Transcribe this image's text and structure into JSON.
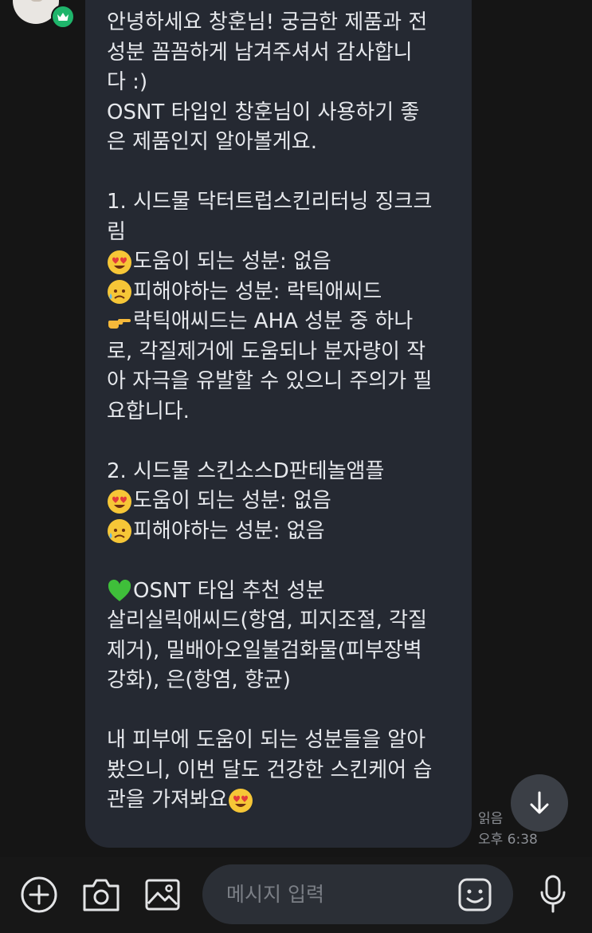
{
  "message": {
    "lines": [
      "안녕하세요 창훈님! 궁금한 제품과 전",
      "성분 꼼꼼하게 남겨주셔서 감사합니",
      "다 :)",
      "OSNT 타입인 창훈님이 사용하기 좋",
      "은 제품인지 알아볼게요.",
      "",
      "1. 시드물 닥터트럽스킨리터닝 징크크",
      "림",
      "도움이 되는 성분: 없음",
      "피해야하는 성분: 락틱애씨드",
      "락틱애씨드는 AHA 성분 중 하나",
      "로, 각질제거에 도움되나 분자량이 작",
      "아 자극을 유발할 수 있으니 주의가 필",
      "요합니다.",
      "",
      "2. 시드물 스킨소스D판테놀앰플",
      "도움이 되는 성분: 없음",
      "피해야하는 성분: 없음",
      "",
      "OSNT 타입 추천 성분",
      "살리실릭애씨드(항염, 피지조절, 각질",
      "제거), 밀배아오일불검화물(피부장벽",
      "강화), 은(항염, 향균)",
      "",
      "내 피부에 도움이 되는 성분들을 알아",
      "봤으니, 이번 달도 건강한 스킨케어 습",
      "관을 가져봐요"
    ],
    "emoji": {
      "line_8": "heart-eyes-emoji",
      "line_9": "sad-sweat-emoji",
      "line_10": "pointing-hand-emoji",
      "line_16": "heart-eyes-emoji",
      "line_17": "sad-sweat-emoji",
      "line_19": "green-heart-emoji",
      "line_26_end": "heart-eyes-emoji"
    },
    "read_status": "읽음",
    "time": "오후 6:38"
  },
  "composer": {
    "placeholder": "메시지 입력"
  },
  "icons": {
    "add": "plus-circle-icon",
    "camera": "camera-icon",
    "gallery": "image-icon",
    "emoticon": "smiley-icon",
    "voice": "microphone-icon",
    "scroll": "arrow-down-icon"
  },
  "colors": {
    "background": "#151515",
    "bubble": "#252932",
    "text": "#e6e8ec",
    "badge": "#1fb56b",
    "input": "#2b2f36"
  }
}
